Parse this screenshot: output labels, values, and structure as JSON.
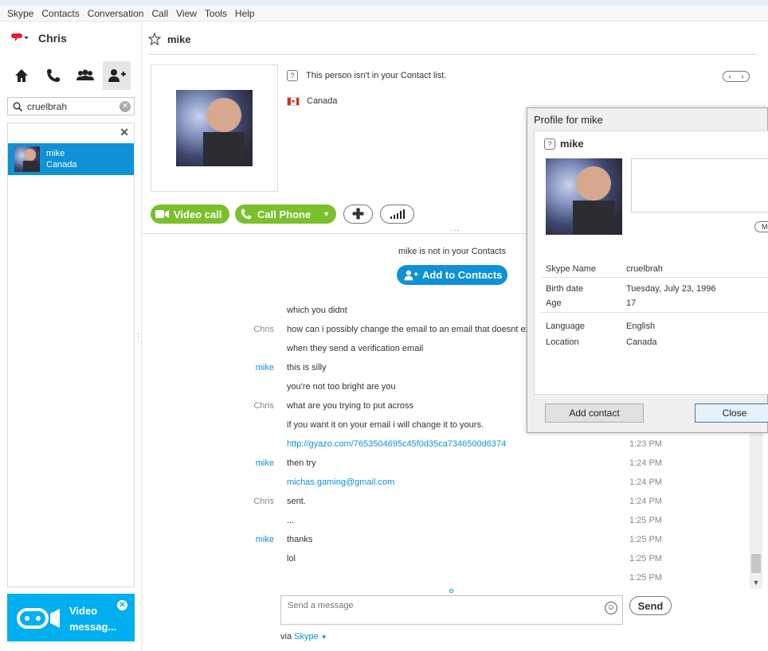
{
  "menu": [
    "Skype",
    "Contacts",
    "Conversation",
    "Call",
    "View",
    "Tools",
    "Help"
  ],
  "user": {
    "name": "Chris"
  },
  "search": {
    "value": "cruelbrah"
  },
  "results": [
    {
      "name": "mike",
      "location": "Canada"
    }
  ],
  "video_message": {
    "label": "Video messag..."
  },
  "conversation": {
    "name": "mike",
    "not_contact_text": "This person isn't in your Contact list.",
    "country": "Canada",
    "video_call": "Video call",
    "call_phone": "Call Phone",
    "not_in_contacts": "mike is not in your Contacts",
    "add_to_contacts": "Add to Contacts"
  },
  "messages": [
    {
      "sender": "",
      "text": "which you didnt",
      "time": "",
      "link": false
    },
    {
      "sender": "Chris",
      "text": "how can i possibly change the email to an email that doesnt exi",
      "time": "",
      "link": false
    },
    {
      "sender": "",
      "text": "when they send a verification email",
      "time": "",
      "link": false
    },
    {
      "sender": "mike",
      "text": "this is silly",
      "time": "",
      "link": false
    },
    {
      "sender": "",
      "text": "you're not too bright are you",
      "time": "",
      "link": false
    },
    {
      "sender": "Chris",
      "text": "what are you trying to put across",
      "time": "",
      "link": false
    },
    {
      "sender": "",
      "text": "if you want it on your email i will change it to yours.",
      "time": "",
      "link": false
    },
    {
      "sender": "",
      "text": "http://gyazo.com/7653504695c45f0d35ca7346500d6374",
      "time": "1:23 PM",
      "link": true
    },
    {
      "sender": "mike",
      "text": "then try",
      "time": "1:24 PM",
      "link": false
    },
    {
      "sender": "",
      "text": "michas.gaming@gmail.com",
      "time": "1:24 PM",
      "link": true
    },
    {
      "sender": "Chris",
      "text": "sent.",
      "time": "1:24 PM",
      "link": false
    },
    {
      "sender": "",
      "text": "...",
      "time": "1:25 PM",
      "link": false
    },
    {
      "sender": "mike",
      "text": "thanks",
      "time": "1:25 PM",
      "link": false
    },
    {
      "sender": "",
      "text": "lol",
      "time": "1:25 PM",
      "link": false
    },
    {
      "sender": "",
      "text": "",
      "time": "1:25 PM",
      "link": false
    }
  ],
  "composer": {
    "placeholder": "Send a message",
    "send": "Send",
    "via_prefix": "via",
    "via_service": "Skype"
  },
  "profile_dialog": {
    "title": "Profile for mike",
    "name": "mike",
    "more_label": "Mo",
    "fields": [
      {
        "key": "Skype Name",
        "value": "cruelbrah"
      },
      {
        "key": "Birth date",
        "value": "Tuesday, July 23, 1996"
      },
      {
        "key": "Age",
        "value": "17"
      },
      {
        "key": "Language",
        "value": "English"
      },
      {
        "key": "Location",
        "value": "Canada"
      }
    ],
    "add_contact": "Add contact",
    "close": "Close"
  },
  "colors": {
    "skype_blue": "#0e91d6",
    "call_green": "#7ac02b",
    "video_tile": "#00aff0",
    "status_red": "#e0202c"
  }
}
